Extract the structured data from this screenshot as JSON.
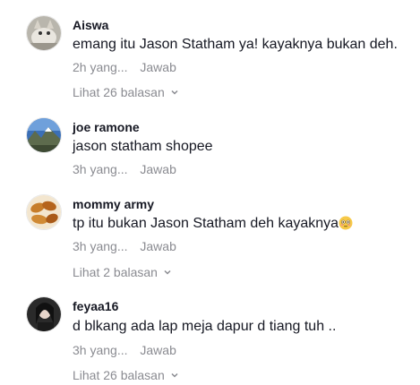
{
  "comments": [
    {
      "username": "Aiswa",
      "text": "emang itu Jason Statham ya! kayaknya bukan deh.",
      "time": "2h yang...",
      "reply_label": "Jawab",
      "view_replies": "Lihat 26 balasan",
      "avatar_icon": "cat-avatar"
    },
    {
      "username": "joe ramone",
      "text": "jason statham shopee",
      "time": "3h yang...",
      "reply_label": "Jawab",
      "avatar_icon": "mountain-avatar"
    },
    {
      "username": "mommy army",
      "text": "tp itu bukan Jason Statham deh kayaknya",
      "emoji": "flushed-face-emoji",
      "time": "3h yang...",
      "reply_label": "Jawab",
      "view_replies": "Lihat 2 balasan",
      "avatar_icon": "food-avatar"
    },
    {
      "username": "feyaa16",
      "text": "d blkang ada lap meja dapur d tiang tuh ..",
      "time": "3h yang...",
      "reply_label": "Jawab",
      "view_replies": "Lihat 26 balasan",
      "avatar_icon": "person-avatar"
    }
  ],
  "colors": {
    "text": "#161823",
    "muted": "#8a8b91"
  }
}
